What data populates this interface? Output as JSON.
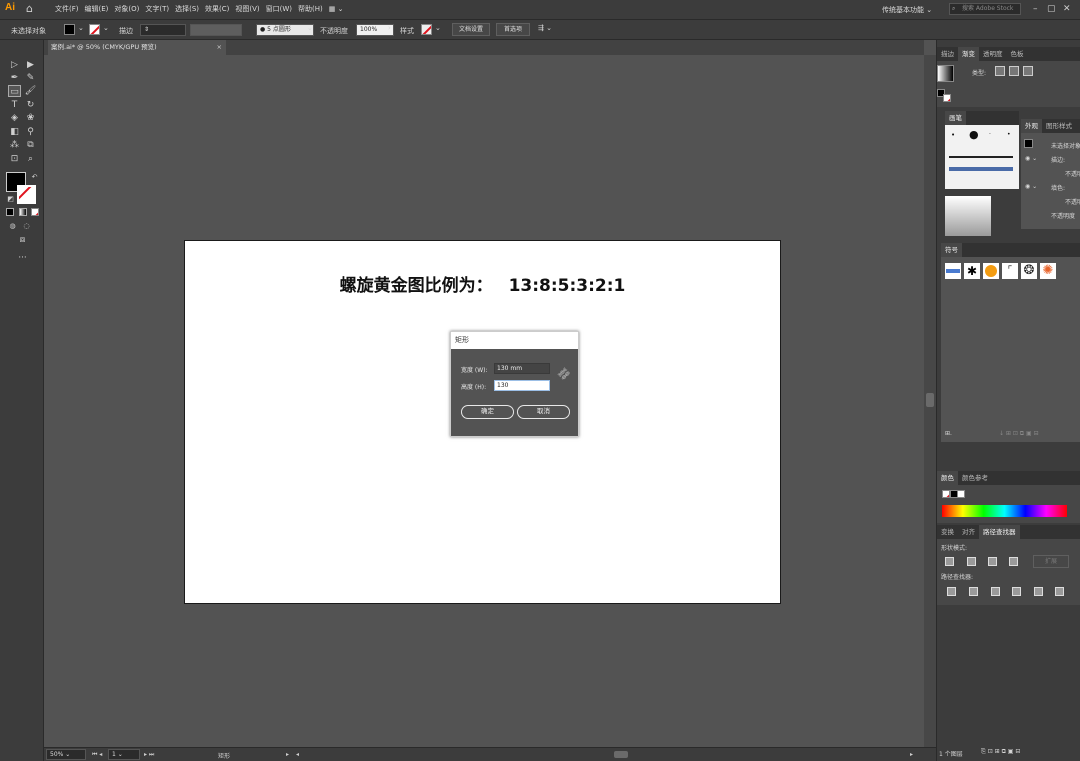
{
  "app": {
    "logo": "Ai"
  },
  "menu": {
    "items": [
      "文件(F)",
      "编辑(E)",
      "对象(O)",
      "文字(T)",
      "选择(S)",
      "效果(C)",
      "视图(V)",
      "窗口(W)",
      "帮助(H)"
    ],
    "workspace": "传统基本功能",
    "search_placeholder": "搜索 Adobe Stock"
  },
  "controlbar": {
    "selection_status": "未选择对象",
    "stroke_label": "描边",
    "brush_label": "5 点圆形",
    "opacity_label": "不透明度",
    "opacity_value": "100%",
    "style_label": "样式",
    "doc_setup_button": "文档设置",
    "prefs_button": "首选项"
  },
  "document_tab": {
    "label": "案例.ai* @ 50% (CMYK/GPU 预览)",
    "close": "×"
  },
  "artboard": {
    "headline_left": "螺旋黄金图比例为：",
    "headline_right": "13:8:5:3:2:1"
  },
  "dialog": {
    "title": "矩形",
    "width_label": "宽度 (W):",
    "width_value": "130 mm",
    "height_label": "高度 (H):",
    "height_value": "130",
    "ok_button": "确定",
    "cancel_button": "取消"
  },
  "statusbar": {
    "zoom": "50%",
    "artboard_num": "1",
    "tool_name": "矩形"
  },
  "panels": {
    "gradient_tabs": [
      "描边",
      "渐变",
      "透明度",
      "色板"
    ],
    "gradient_type_label": "类型:",
    "brush_panel_title": "画笔",
    "appearance_tabs": [
      "外观",
      "图形样式"
    ],
    "appearance_rows": [
      "未选择对象",
      "描边:",
      "不透明",
      "填色:",
      "不透明",
      "不透明度"
    ],
    "symbols_title": "符号",
    "color_tabs": [
      "颜色",
      "颜色参考"
    ],
    "pathfinder_tabs": [
      "变换",
      "对齐",
      "路径查找器"
    ],
    "shape_modes_label": "形状模式:",
    "expand_button": "扩展",
    "pathfinders_label": "路径查找器:",
    "layers_status": "1 个图层"
  }
}
